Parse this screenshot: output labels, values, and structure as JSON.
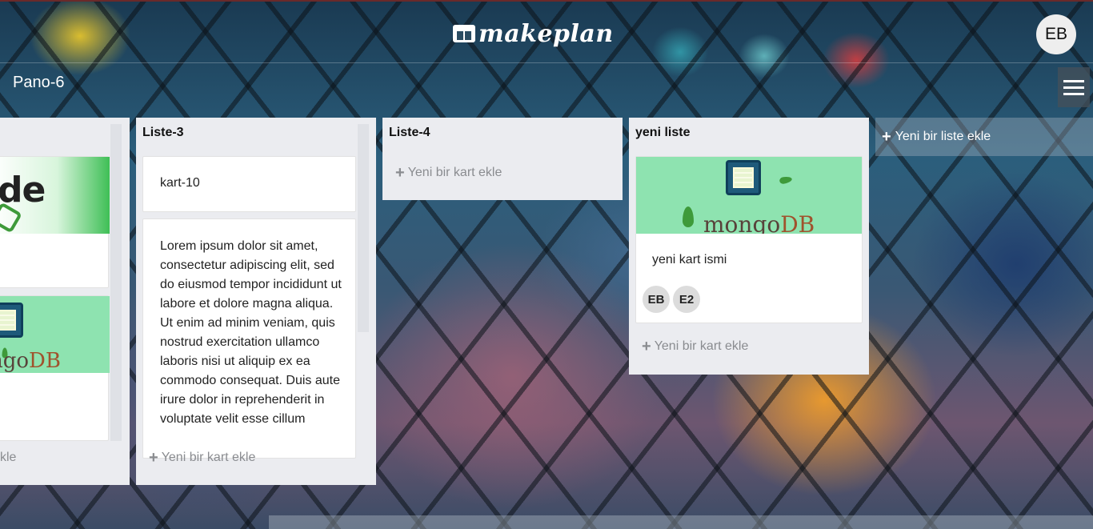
{
  "app": {
    "brand": "makeplan",
    "user_initials": "EB"
  },
  "board": {
    "title": "Pano-6"
  },
  "lists": [
    {
      "title": "",
      "add_card_label": "kle"
    },
    {
      "title": "Liste-3",
      "cards": [
        {
          "text": "kart-10"
        },
        {
          "text": "Lorem ipsum dolor sit amet, consectetur adipiscing elit, sed do eiusmod tempor incididunt ut labore et dolore magna aliqua. Ut enim ad minim veniam, quis nostrud exercitation ullamco laboris nisi ut aliquip ex ea commodo consequat. Duis aute irure dolor in reprehenderit in voluptate velit esse cillum"
        }
      ],
      "add_card_label": "Yeni bir kart ekle"
    },
    {
      "title": "Liste-4",
      "add_card_label": "Yeni bir kart ekle"
    },
    {
      "title": "yeni liste",
      "cards": [
        {
          "text": "yeni kart ismi",
          "cover": "mongo",
          "members": [
            "EB",
            "E2"
          ]
        }
      ],
      "add_card_label": "Yeni bir kart ekle"
    }
  ],
  "cover_text": {
    "mongo_prefix": "mongo",
    "mongo_suffix": "DB",
    "mongo_partial_prefix": "ngo",
    "node_partial": "de"
  },
  "add_list_label": "Yeni bir liste ekle",
  "icons": {
    "menu": "hamburger-icon",
    "plus": "plus-icon",
    "logo": "board-logo-icon"
  }
}
